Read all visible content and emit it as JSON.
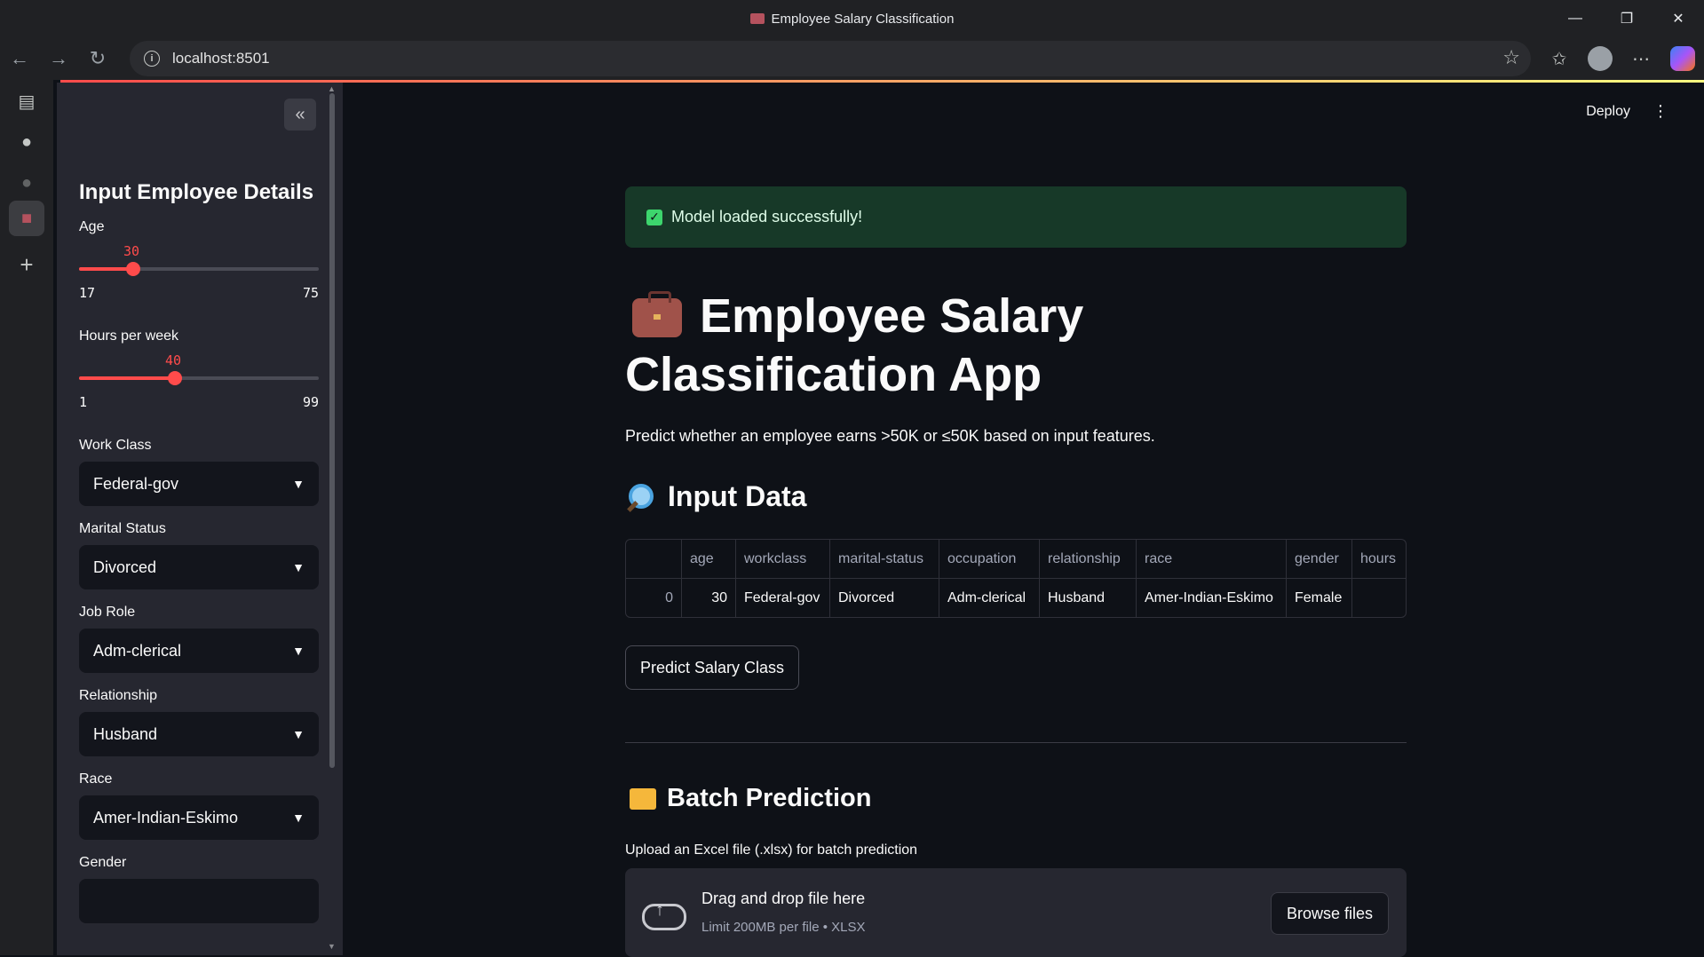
{
  "window": {
    "title": "Employee Salary Classification",
    "controls": [
      "—",
      "❐",
      "✕"
    ]
  },
  "browser": {
    "url": "localhost:8501"
  },
  "sidebar": {
    "collapse_label": "«",
    "header": "Input Employee Details",
    "sliders": [
      {
        "label": "Age",
        "value": 30,
        "min": 17,
        "max": 75
      },
      {
        "label": "Hours per week",
        "value": 40,
        "min": 1,
        "max": 99
      }
    ],
    "selects": [
      {
        "label": "Work Class",
        "value": "Federal-gov"
      },
      {
        "label": "Marital Status",
        "value": "Divorced"
      },
      {
        "label": "Job Role",
        "value": "Adm-clerical"
      },
      {
        "label": "Relationship",
        "value": "Husband"
      },
      {
        "label": "Race",
        "value": "Amer-Indian-Eskimo"
      }
    ],
    "gender_label": "Gender"
  },
  "header": {
    "deploy_label": "Deploy"
  },
  "main": {
    "success_message": "Model loaded successfully!",
    "title": "Employee Salary Classification App",
    "description": "Predict whether an employee earns >50K or ≤50K based on input features.",
    "input_heading": "Input Data",
    "table": {
      "columns": [
        "",
        "age",
        "workclass",
        "marital-status",
        "occupation",
        "relationship",
        "race",
        "gender",
        "hours"
      ],
      "rows": [
        [
          "0",
          "30",
          "Federal-gov",
          "Divorced",
          "Adm-clerical",
          "Husband",
          "Amer-Indian-Eskimo",
          "Female",
          ""
        ]
      ]
    },
    "predict_button": "Predict Salary Class",
    "batch_heading": "Batch Prediction",
    "upload_label": "Upload an Excel file (.xlsx) for batch prediction",
    "dropzone_title": "Drag and drop file here",
    "dropzone_sub": "Limit 200MB per file • XLSX",
    "browse_button": "Browse files"
  },
  "colors": {
    "accent": "#ff4b4b",
    "success_bg": "#173928",
    "background": "#0e1117",
    "sidebar_bg": "#262730"
  }
}
